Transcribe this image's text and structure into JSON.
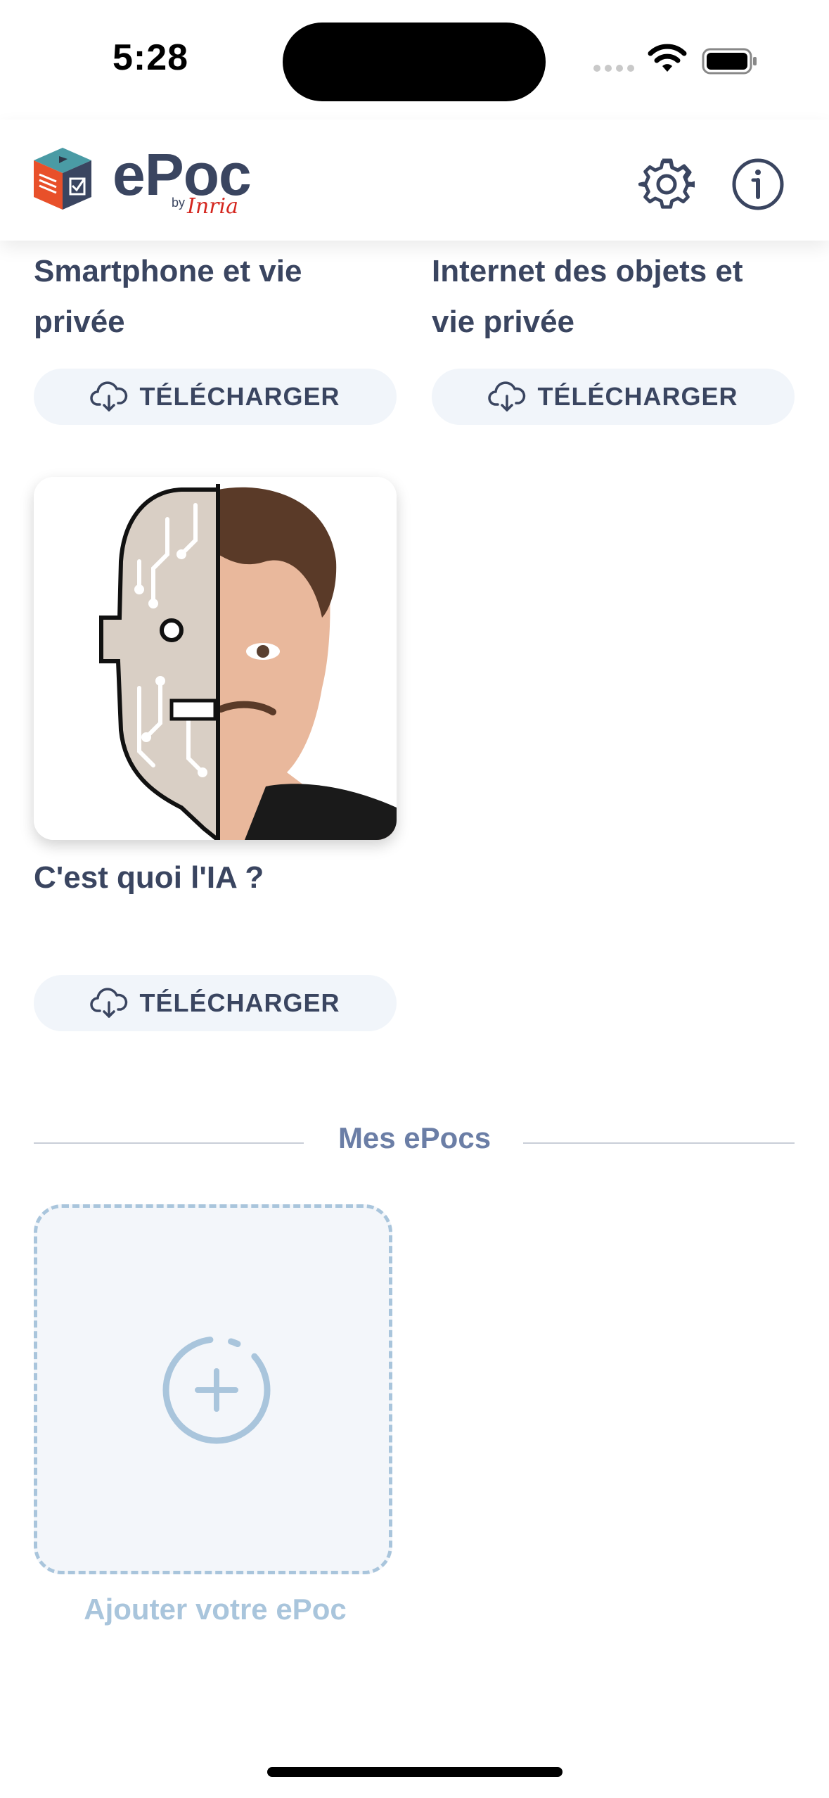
{
  "status_bar": {
    "time": "5:28"
  },
  "header": {
    "logo_text": "ePoc",
    "logo_by": "by",
    "logo_inria": "Inria"
  },
  "catalog": {
    "cards": [
      {
        "title_line1": "Smartphone et vie",
        "title_line2": "privée",
        "button": "TÉLÉCHARGER"
      },
      {
        "title_line1": "Internet des objets et",
        "title_line2": "vie privée",
        "button": "TÉLÉCHARGER"
      },
      {
        "title_line1": "C'est quoi l'IA ?",
        "button": "TÉLÉCHARGER"
      }
    ]
  },
  "my_epocs": {
    "section_title": "Mes ePocs",
    "add_label": "Ajouter votre ePoc"
  },
  "colors": {
    "text_primary": "#3a4560",
    "section_title": "#6b7ea6",
    "accent_light": "#a9c5dc",
    "button_bg": "#f1f5fa",
    "inria_red": "#d4261e"
  },
  "icons": [
    "settings-icon",
    "info-icon",
    "cloud-download-icon",
    "add-circle-icon"
  ]
}
